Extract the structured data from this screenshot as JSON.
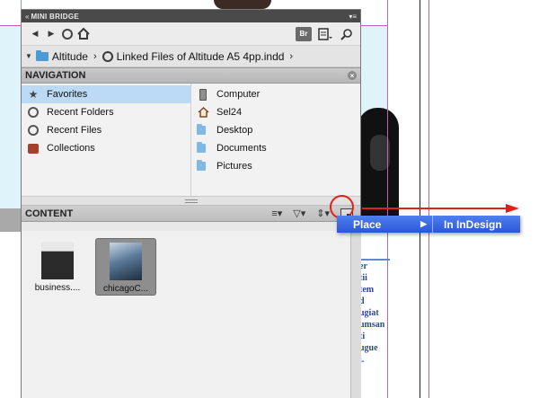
{
  "panel": {
    "title": "MINI BRIDGE",
    "collapse_glyph": "«",
    "menu_glyph": "▾≡"
  },
  "toolbar": {
    "back": "◀",
    "forward": "▶",
    "bridge_label": "Br"
  },
  "path": {
    "segments": [
      "Altitude",
      "Linked Files of Altitude A5 4pp.indd"
    ],
    "separator": "›"
  },
  "navigation": {
    "header": "NAVIGATION",
    "close_glyph": "×",
    "left_items": [
      {
        "label": "Favorites",
        "icon": "star-icon"
      },
      {
        "label": "Recent Folders",
        "icon": "recent-folders-icon"
      },
      {
        "label": "Recent Files",
        "icon": "recent-files-icon"
      },
      {
        "label": "Collections",
        "icon": "collections-icon"
      }
    ],
    "right_items": [
      {
        "label": "Computer",
        "icon": "computer-icon"
      },
      {
        "label": "Sel24",
        "icon": "home-icon"
      },
      {
        "label": "Desktop",
        "icon": "folder-icon"
      },
      {
        "label": "Documents",
        "icon": "folder-icon"
      },
      {
        "label": "Pictures",
        "icon": "folder-icon"
      }
    ]
  },
  "content": {
    "header": "CONTENT",
    "tools": {
      "sort": "≡▾",
      "filter": "▽▾",
      "order": "⇕▾"
    },
    "thumbnails": [
      {
        "label": "business...."
      },
      {
        "label": "chicagoC..."
      }
    ]
  },
  "context_menu": {
    "place_label": "Place",
    "submenu_arrow": "▶",
    "submenu_label": "In InDesign"
  },
  "document_text": [
    "er",
    "tii",
    "tem",
    "d",
    "ugiat",
    "umsan",
    "ti",
    "ugue",
    "i."
  ],
  "colors": {
    "selection": "#bcd9f5",
    "menu_highlight": "#2a57d6",
    "annotation": "#e0201a"
  }
}
